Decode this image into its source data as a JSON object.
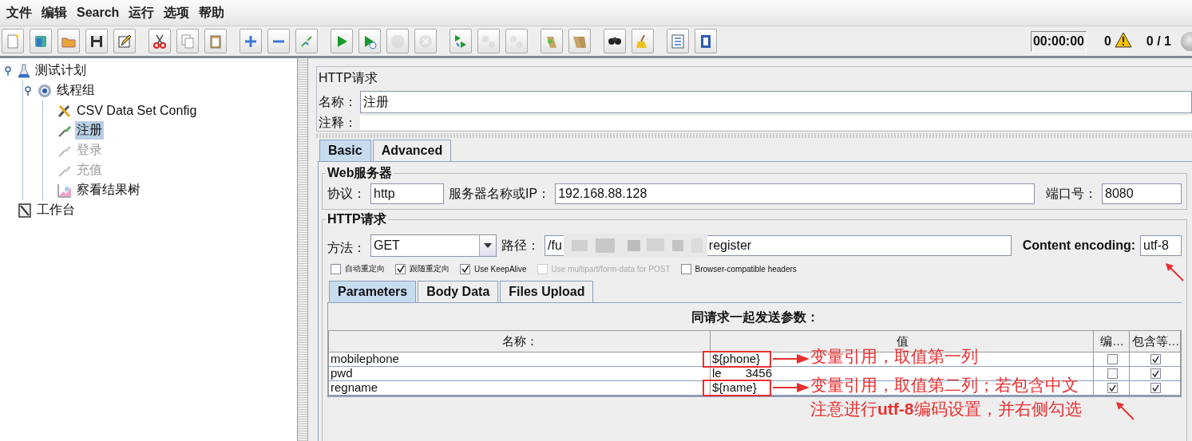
{
  "menu": [
    "文件",
    "编辑",
    "Search",
    "运行",
    "选项",
    "帮助"
  ],
  "toolbar": [
    [
      {
        "disabled": false
      },
      {
        "disabled": false
      },
      {
        "disabled": false
      },
      {
        "disabled": false
      },
      {
        "disabled": false
      }
    ],
    [
      {
        "disabled": false
      },
      {
        "disabled": false
      },
      {
        "disabled": false
      }
    ],
    [
      {
        "disabled": false
      },
      {
        "disabled": false
      },
      {
        "disabled": false
      }
    ],
    [
      {
        "disabled": false
      },
      {
        "disabled": false
      },
      {
        "disabled": true
      },
      {
        "disabled": true
      }
    ],
    [
      {
        "disabled": false
      },
      {
        "disabled": true
      },
      {
        "disabled": true
      }
    ],
    [
      {
        "disabled": false
      },
      {
        "disabled": false
      }
    ],
    [
      {
        "disabled": false
      },
      {
        "disabled": false
      }
    ],
    [
      {
        "disabled": false
      },
      {
        "disabled": false
      }
    ]
  ],
  "status": {
    "timer": "00:00:00",
    "warnings": "0",
    "threads": "0 / 1"
  },
  "tree": [
    {
      "label": "测试计划",
      "kind": "plan",
      "selected": false,
      "disabled": false,
      "expanded": true,
      "children": [
        {
          "label": "线程组",
          "kind": "threads",
          "selected": false,
          "disabled": false,
          "expanded": true,
          "children": [
            {
              "label": "CSV Data Set Config",
              "kind": "config",
              "selected": false,
              "disabled": false
            },
            {
              "label": "注册",
              "kind": "sampler",
              "selected": true,
              "disabled": false
            },
            {
              "label": "登录",
              "kind": "sampler",
              "selected": false,
              "disabled": true
            },
            {
              "label": "充值",
              "kind": "sampler",
              "selected": false,
              "disabled": true
            },
            {
              "label": "察看结果树",
              "kind": "listener",
              "selected": false,
              "disabled": false
            }
          ]
        }
      ]
    },
    {
      "label": "工作台",
      "kind": "workbench",
      "selected": false,
      "disabled": false
    }
  ],
  "editor": {
    "title": "HTTP请求",
    "name_label": "名称：",
    "name_value": "注册",
    "comment_label": "注释：",
    "tabs": [
      {
        "label": "Basic",
        "selected": true
      },
      {
        "label": "Advanced",
        "selected": false
      }
    ],
    "web_server": {
      "legend": "Web服务器",
      "protocol_label": "协议：",
      "protocol": "http",
      "server_label": "服务器名称或IP：",
      "server": "192.168.88.128",
      "port_label": "端口号：",
      "port": "8080"
    },
    "http_request": {
      "legend": "HTTP请求",
      "method_label": "方法：",
      "method": "GET",
      "path_label": "路径：",
      "path_start": "/fu",
      "path_end": "register",
      "encoding_label": "Content encoding:",
      "encoding": "utf-8",
      "options": [
        {
          "label": "自动重定向",
          "checked": false,
          "disabled": false
        },
        {
          "label": "跟随重定向",
          "checked": true,
          "disabled": false
        },
        {
          "label": "Use KeepAlive",
          "checked": true,
          "disabled": false
        },
        {
          "label": "Use multipart/form-data for POST",
          "checked": false,
          "disabled": true
        },
        {
          "label": "Browser-compatible headers",
          "checked": false,
          "disabled": false
        }
      ]
    },
    "param_tabs": [
      {
        "label": "Parameters",
        "selected": true
      },
      {
        "label": "Body Data",
        "selected": false
      },
      {
        "label": "Files Upload",
        "selected": false
      }
    ],
    "params": {
      "heading": "同请求一起发送参数：",
      "columns": [
        "名称：",
        "值",
        "编…",
        "包含等…"
      ],
      "rows": [
        {
          "name": "mobilephone",
          "value_parts": [
            "${phone}"
          ],
          "encode": false,
          "include_equals": true,
          "marked": true,
          "note": [
            "变量引用，取值第一列"
          ]
        },
        {
          "name": "pwd",
          "value_parts": [
            "le",
            "3456"
          ],
          "encode": false,
          "include_equals": true,
          "marked": false
        },
        {
          "name": "regname",
          "value_parts": [
            "${name}"
          ],
          "encode": true,
          "include_equals": true,
          "marked": true,
          "note": [
            "变量引用，取值第二列；若包含中文",
            "注意进行**utf-8**编码设置，并右侧勾选"
          ]
        }
      ]
    }
  }
}
